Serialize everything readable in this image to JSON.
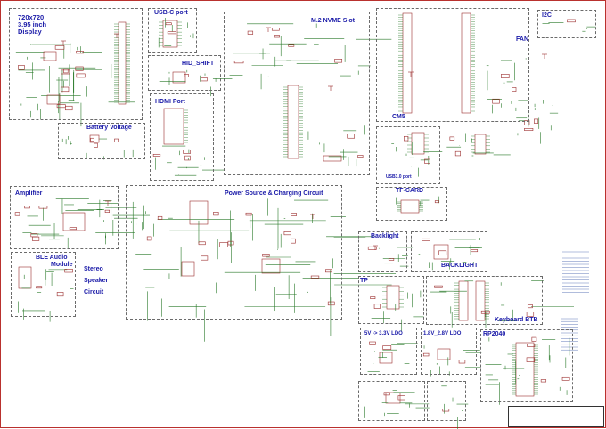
{
  "diagram": {
    "display_title_line1": "720x720",
    "display_title_line2": "3.95 inch",
    "display_title_line3": "Display",
    "usbc": "USB-C port",
    "hid_shift": "HID_SHIFT",
    "hdmi": "HDMI Port",
    "battery": "Battery Voltage",
    "m2": "M.2 NVME Slot",
    "i2c": "I2C",
    "fan": "FAN",
    "cm5": "CM5",
    "usb3": "USB3.0 port",
    "amplifier": "Amplifier",
    "power": "Power Source & Charging Circuit",
    "ble_line1": "BLE  Audio",
    "ble_line2": "Module",
    "stereo_line1": "Stereo",
    "stereo_line2": "Speaker",
    "stereo_line3": "Circuit",
    "tfcard": "TF-CARD",
    "backlight": "Backlight",
    "backlight_caps": "BACKLIGHT",
    "tp": "TP",
    "keyboard": "Keyboard BTB",
    "ldo1": "5V -> 3.3V LDO",
    "ldo2": "1.8V_2.8V LDO",
    "rp2040": "RP2040"
  },
  "colors": {
    "wire": "#2a7a2a",
    "component": "#9b2d2d",
    "title": "#1a1aa8",
    "border": "#6b6b6b"
  }
}
